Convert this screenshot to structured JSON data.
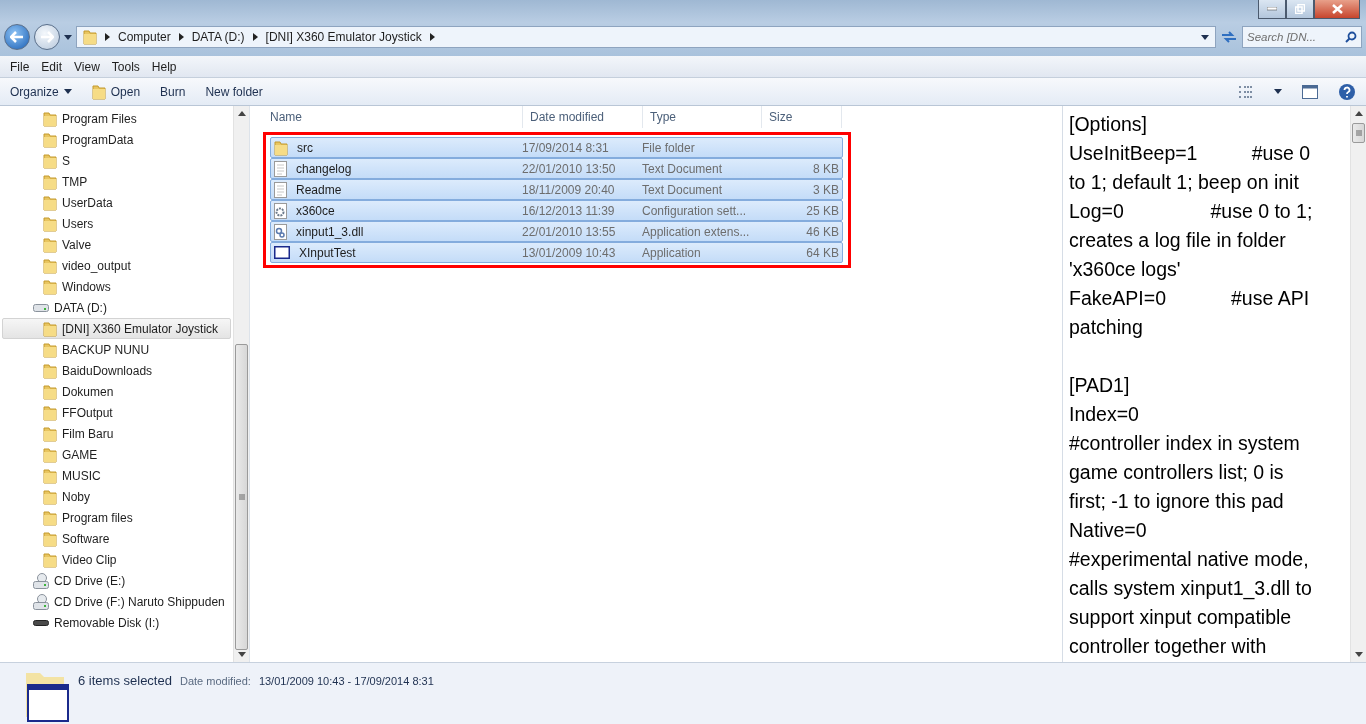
{
  "address": {
    "crumbs": [
      "Computer",
      "DATA (D:)",
      "[DNI] X360 Emulator Joystick"
    ],
    "search_placeholder": "Search [DN..."
  },
  "menu": [
    "File",
    "Edit",
    "View",
    "Tools",
    "Help"
  ],
  "commands": [
    {
      "label": "Organize",
      "kind": "dropdown"
    },
    {
      "label": "Open",
      "kind": "open"
    },
    {
      "label": "Burn",
      "kind": "plain"
    },
    {
      "label": "New folder",
      "kind": "plain"
    }
  ],
  "nav": {
    "loose_folders": [
      {
        "label": "Program Files",
        "selected": false
      },
      {
        "label": "ProgramData",
        "selected": false
      },
      {
        "label": "S",
        "selected": false
      },
      {
        "label": "TMP",
        "selected": false
      },
      {
        "label": "UserData",
        "selected": false
      },
      {
        "label": "Users",
        "selected": false
      },
      {
        "label": "Valve",
        "selected": false
      },
      {
        "label": "video_output",
        "selected": false
      },
      {
        "label": "Windows",
        "selected": false
      }
    ],
    "drives": [
      {
        "label": "DATA (D:)",
        "kind": "disk",
        "selected": false,
        "children": [
          {
            "label": "[DNI] X360 Emulator Joystick",
            "selected": true
          },
          {
            "label": "BACKUP NUNU",
            "selected": false
          },
          {
            "label": "BaiduDownloads",
            "selected": false
          },
          {
            "label": "Dokumen",
            "selected": false
          },
          {
            "label": "FFOutput",
            "selected": false
          },
          {
            "label": "Film Baru",
            "selected": false
          },
          {
            "label": "GAME",
            "selected": false
          },
          {
            "label": "MUSIC",
            "selected": false
          },
          {
            "label": "Noby",
            "selected": false
          },
          {
            "label": "Program files",
            "selected": false
          },
          {
            "label": "Software",
            "selected": false
          },
          {
            "label": "Video Clip",
            "selected": false
          }
        ]
      },
      {
        "label": "CD Drive (E:)",
        "kind": "cd",
        "selected": false
      },
      {
        "label": "CD Drive (F:) Naruto Shippuden",
        "kind": "cd",
        "selected": false
      },
      {
        "label": "Removable Disk (I:)",
        "kind": "removable",
        "selected": false
      }
    ]
  },
  "table": {
    "columns": [
      "Name",
      "Date modified",
      "Type",
      "Size"
    ],
    "rows": [
      {
        "name": "src",
        "kind": "folder",
        "date": "17/09/2014 8:31",
        "type": "File folder",
        "selected": true
      },
      {
        "name": "changelog",
        "kind": "text",
        "date": "22/01/2010 13:50",
        "type": "Text Document",
        "size": "8 KB",
        "selected": true
      },
      {
        "name": "Readme",
        "kind": "text",
        "date": "18/11/2009 20:40",
        "type": "Text Document",
        "size": "3 KB",
        "selected": true
      },
      {
        "name": "x360ce",
        "kind": "config",
        "date": "16/12/2013 11:39",
        "type": "Configuration sett...",
        "size": "25 KB",
        "selected": true
      },
      {
        "name": "xinput1_3.dll",
        "kind": "dll",
        "date": "22/01/2010 13:55",
        "type": "Application extens...",
        "size": "46 KB",
        "selected": true
      },
      {
        "name": "XInputTest",
        "kind": "app",
        "date": "13/01/2009 10:43",
        "type": "Application",
        "size": "64 KB",
        "selected": true
      }
    ]
  },
  "preview": {
    "paragraphs": [
      [
        "[Options]",
        "UseInitBeep=1          #use 0",
        "to 1; default 1; beep on init",
        "Log=0                #use 0 to 1;",
        "creates a log file in folder",
        "'x360ce logs'",
        "FakeAPI=0            #use API",
        "patching"
      ],
      [
        "[PAD1]",
        "Index=0",
        "#controller index in system",
        "game controllers list; 0 is",
        "first; -1 to ignore this pad",
        "Native=0",
        "#experimental native mode,",
        "calls system xinput1_3.dll to",
        "support xinput compatible",
        "controller together with"
      ]
    ]
  },
  "status": {
    "summary": "6 items selected",
    "label": "Date modified:",
    "value": "13/01/2009 10:43 - 17/09/2014 8:31"
  }
}
